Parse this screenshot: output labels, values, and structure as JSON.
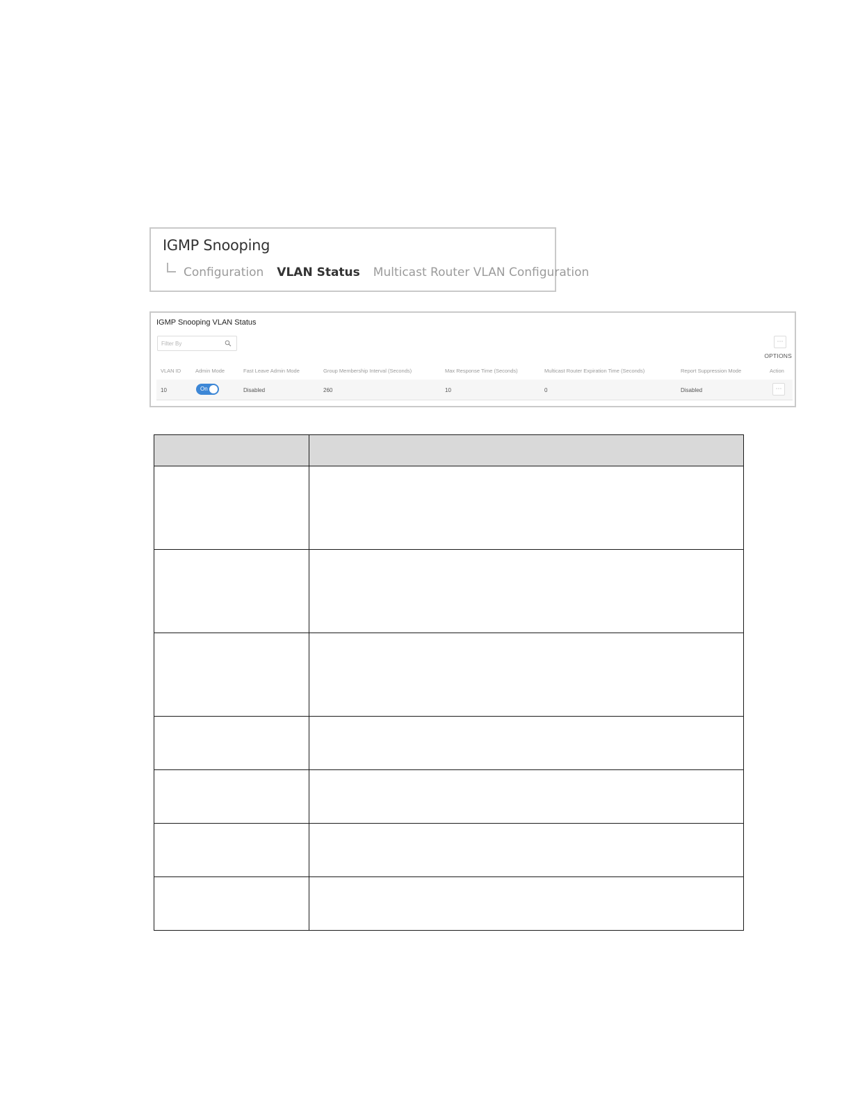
{
  "breadcrumb": {
    "title": "IGMP Snooping",
    "tabs": [
      {
        "label": "Configuration",
        "active": false
      },
      {
        "label": "VLAN Status",
        "active": true
      },
      {
        "label": "Multicast Router VLAN Configuration",
        "active": false
      }
    ]
  },
  "status_table": {
    "title": "IGMP Snooping VLAN Status",
    "filter_placeholder": "Filter By",
    "options_label": "OPTIONS",
    "columns": [
      "VLAN ID",
      "Admin Mode",
      "Fast Leave Admin Mode",
      "Group Membership Interval (Seconds)",
      "Max Response Time (Seconds)",
      "Multicast Router Expiration Time (Seconds)",
      "Report Suppression Mode",
      "Action"
    ],
    "rows": [
      {
        "vlan_id": "10",
        "admin_mode": "On",
        "fast_leave": "Disabled",
        "group_membership_interval": "260",
        "max_response_time": "10",
        "mrouter_expiration": "0",
        "report_suppression": "Disabled"
      }
    ],
    "toggle_color": "#3d87d6"
  },
  "description_table": {
    "header_color": "#d9d9d9",
    "row_count": 7
  }
}
